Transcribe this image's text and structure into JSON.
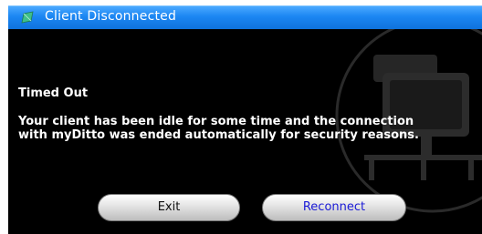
{
  "window": {
    "title": "Client Disconnected",
    "icon": "app-leaf-icon"
  },
  "content": {
    "heading": "Timed Out",
    "message_line1": "Your client has been idle for some time and the connection",
    "message_line2": "with myDitto was ended automatically for security reasons.",
    "watermark_icon": "network-computer-icon"
  },
  "buttons": {
    "exit_label": "Exit",
    "reconnect_label": "Reconnect"
  },
  "colors": {
    "titlebar": "#1b86f2",
    "content_bg": "#000000",
    "reconnect_text": "#1a1ad6"
  }
}
